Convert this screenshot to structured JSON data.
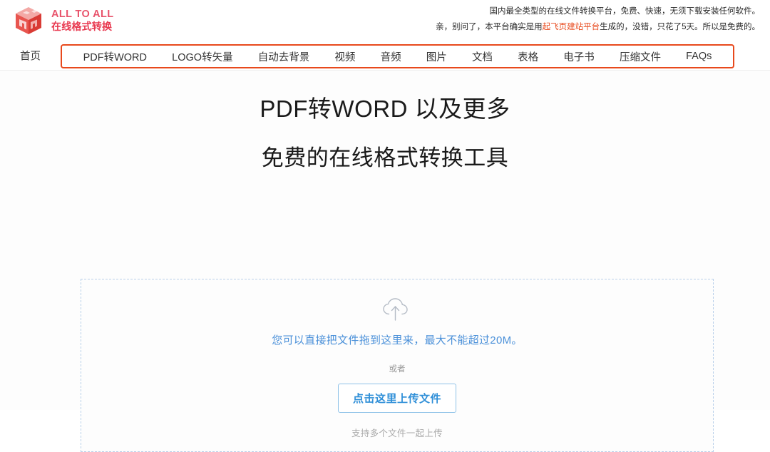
{
  "brand": {
    "title": "ALL TO ALL",
    "subtitle": "在线格式转换",
    "logo_icon": "cube-icon",
    "title_color": "#e8536b",
    "subtitle_color": "#e8384f"
  },
  "header": {
    "note_line_1": "国内最全类型的在线文件转换平台，免费、快速，无须下载安装任何软件。",
    "note_line_2_prefix": "亲，别问了，本平台确实是用",
    "note_line_2_highlight": "起飞页建站平台",
    "note_line_2_suffix": "生成的，没错，只花了5天。所以是免费的。",
    "highlight_color": "#e8491c"
  },
  "nav": {
    "home_label": "首页",
    "box_border_color": "#e8491c",
    "items": [
      {
        "label": "PDF转WORD"
      },
      {
        "label": "LOGO转矢量"
      },
      {
        "label": "自动去背景"
      },
      {
        "label": "视频"
      },
      {
        "label": "音频"
      },
      {
        "label": "图片"
      },
      {
        "label": "文档"
      },
      {
        "label": "表格"
      },
      {
        "label": "电子书"
      },
      {
        "label": "压缩文件"
      },
      {
        "label": "FAQs"
      }
    ]
  },
  "hero": {
    "heading_1": "PDF转WORD 以及更多",
    "heading_2": "免费的在线格式转换工具"
  },
  "dropzone": {
    "icon": "cloud-upload-icon",
    "drag_text": "您可以直接把文件拖到这里来，最大不能超过20M。",
    "or_label": "或者",
    "upload_button_label": "点击这里上传文件",
    "support_text": "支持多个文件一起上传",
    "accent_color": "#4a90d9",
    "border_color": "#b9d0ea"
  }
}
